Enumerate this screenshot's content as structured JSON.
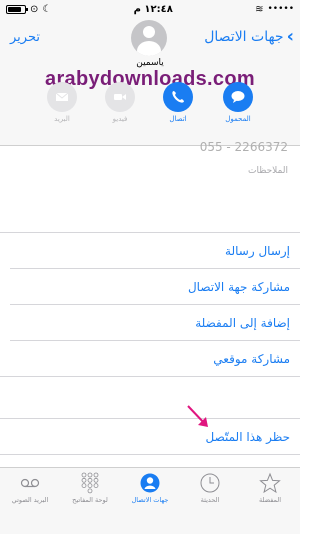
{
  "status_bar": {
    "time": "١٢:٤٨ م",
    "battery_level": 0.8,
    "carrier": "•••••",
    "accent": "#000000"
  },
  "header": {
    "back_label": "جهات الاتصال",
    "edit_label": "تحرير",
    "contact_name": "ياسمين",
    "watermark": "arabydownloads.com",
    "watermark_color": "#7a1e78",
    "accent": "#1a7df2"
  },
  "actions": [
    {
      "label": "المحمول",
      "icon": "message-icon",
      "enabled": true
    },
    {
      "label": "اتصال",
      "icon": "phone-icon",
      "enabled": true
    },
    {
      "label": "فيديو",
      "icon": "video-icon",
      "enabled": false
    },
    {
      "label": "البريد",
      "icon": "mail-icon",
      "enabled": false
    }
  ],
  "details": {
    "phone_partial": "055 - 2266372",
    "notes_label": "الملاحظات"
  },
  "rows": [
    {
      "label": "إرسال رسالة"
    },
    {
      "label": "مشاركة جهة الاتصال"
    },
    {
      "label": "إضافة إلى المفضلة"
    },
    {
      "label": "مشاركة موقعي"
    },
    {
      "label": "حظر هذا المتّصل"
    }
  ],
  "arrow_color": "#e0157f",
  "tabs": [
    {
      "label": "المفضلة",
      "icon": "star-icon",
      "active": false
    },
    {
      "label": "الحديثة",
      "icon": "clock-icon",
      "active": false
    },
    {
      "label": "جهات الاتصال",
      "icon": "contacts-icon",
      "active": true
    },
    {
      "label": "لوحة المفاتيح",
      "icon": "keypad-icon",
      "active": false
    },
    {
      "label": "البريد الصوتي",
      "icon": "voicemail-icon",
      "active": false
    }
  ]
}
